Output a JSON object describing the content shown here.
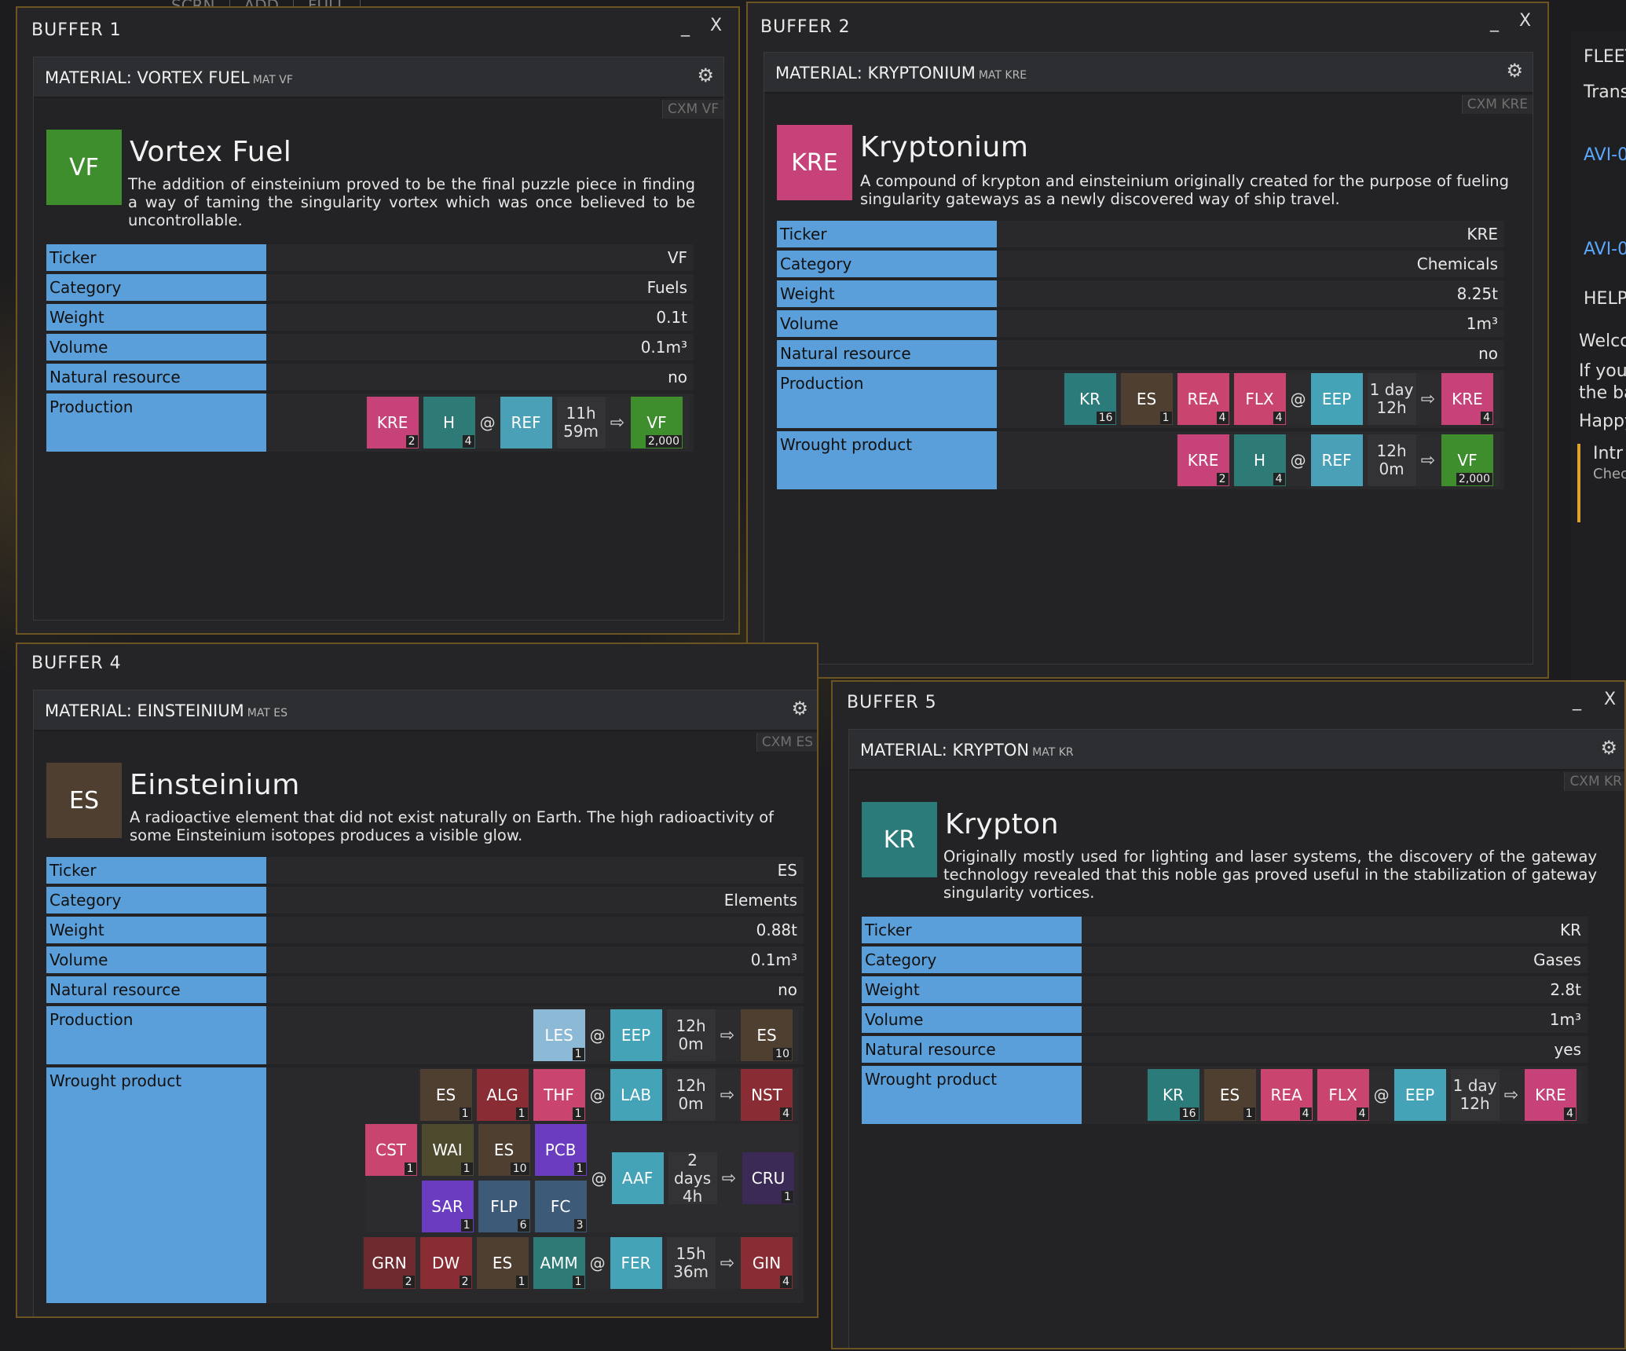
{
  "topbar": [
    "SCRN",
    "ADD",
    "FULL"
  ],
  "right_panel": {
    "fleet": "FLEET",
    "trans": "Trans",
    "avi1": "AVI-0",
    "avi2": "AVI-0",
    "help": "HELP",
    "welc": "Welco",
    "ifyou": "If you",
    "theba": "the ba",
    "happy": "Happy",
    "intr": "Intr",
    "chec": "Chec"
  },
  "buffer1": {
    "title": "BUFFER 1",
    "minimize": "_",
    "close": "X",
    "header": "MATERIAL: VORTEX FUEL",
    "header_small": "MAT VF",
    "cxm": "CXM VF",
    "icon": "VF",
    "name": "Vortex Fuel",
    "desc": "The addition of einsteinium proved to be the final puzzle piece in finding a way of taming the singularity vortex which was once believed to be uncontrollable.",
    "rows": [
      {
        "label": "Ticker",
        "value": "VF"
      },
      {
        "label": "Category",
        "value": "Fuels"
      },
      {
        "label": "Weight",
        "value": "0.1t"
      },
      {
        "label": "Volume",
        "value": "0.1m³"
      },
      {
        "label": "Natural resource",
        "value": "no"
      }
    ],
    "production_label": "Production",
    "production": {
      "inputs": [
        {
          "t": "KRE",
          "n": "2"
        },
        {
          "t": "H",
          "n": "4"
        }
      ],
      "at": "@",
      "building": "REF",
      "dur1": "11h",
      "dur2": "59m",
      "arrow": "⇨",
      "output": {
        "t": "VF",
        "n": "2,000"
      }
    }
  },
  "buffer2": {
    "title": "BUFFER 2",
    "minimize": "_",
    "close": "X",
    "header": "MATERIAL: KRYPTONIUM",
    "header_small": "MAT KRE",
    "cxm": "CXM KRE",
    "icon": "KRE",
    "name": "Kryptonium",
    "desc": "A compound of krypton and einsteinium originally created for the purpose of fueling singularity gateways as a newly discovered way of ship travel.",
    "rows": [
      {
        "label": "Ticker",
        "value": "KRE"
      },
      {
        "label": "Category",
        "value": "Chemicals"
      },
      {
        "label": "Weight",
        "value": "8.25t"
      },
      {
        "label": "Volume",
        "value": "1m³"
      },
      {
        "label": "Natural resource",
        "value": "no"
      }
    ],
    "production_label": "Production",
    "production": {
      "inputs": [
        {
          "t": "KR",
          "n": "16"
        },
        {
          "t": "ES",
          "n": "1"
        },
        {
          "t": "REA",
          "n": "4"
        },
        {
          "t": "FLX",
          "n": "4"
        }
      ],
      "at": "@",
      "building": "EEP",
      "dur1": "1 day",
      "dur2": "12h",
      "arrow": "⇨",
      "output": {
        "t": "KRE",
        "n": "4"
      }
    },
    "wrought_label": "Wrought product",
    "wrought": {
      "inputs": [
        {
          "t": "KRE",
          "n": "2"
        },
        {
          "t": "H",
          "n": "4"
        }
      ],
      "at": "@",
      "building": "REF",
      "dur1": "12h",
      "dur2": "0m",
      "arrow": "⇨",
      "output": {
        "t": "VF",
        "n": "2,000"
      }
    }
  },
  "buffer4": {
    "title": "BUFFER 4",
    "header": "MATERIAL: EINSTEINIUM",
    "header_small": "MAT ES",
    "cxm": "CXM ES",
    "icon": "ES",
    "name": "Einsteinium",
    "desc": "A radioactive element that did not exist naturally on Earth. The high radioactivity of some Einsteinium isotopes produces a visible glow.",
    "rows": [
      {
        "label": "Ticker",
        "value": "ES"
      },
      {
        "label": "Category",
        "value": "Elements"
      },
      {
        "label": "Weight",
        "value": "0.88t"
      },
      {
        "label": "Volume",
        "value": "0.1m³"
      },
      {
        "label": "Natural resource",
        "value": "no"
      }
    ],
    "production_label": "Production",
    "production": {
      "inputs": [
        {
          "t": "LES",
          "n": "1"
        }
      ],
      "at": "@",
      "building": "EEP",
      "dur1": "12h",
      "dur2": "0m",
      "arrow": "⇨",
      "output": {
        "t": "ES",
        "n": "10"
      }
    },
    "wrought_label": "Wrought product",
    "w1": {
      "inputs": [
        {
          "t": "ES",
          "n": "1"
        },
        {
          "t": "ALG",
          "n": "1"
        },
        {
          "t": "THF",
          "n": "1"
        }
      ],
      "building": "LAB",
      "dur1": "12h",
      "dur2": "0m",
      "output": {
        "t": "NST",
        "n": "4"
      }
    },
    "w2": {
      "inputs_a": [
        {
          "t": "CST",
          "n": "1"
        },
        {
          "t": "WAI",
          "n": "1"
        },
        {
          "t": "ES",
          "n": "10"
        },
        {
          "t": "PCB",
          "n": "1"
        }
      ],
      "inputs_b": [
        {
          "t": "SAR",
          "n": "1"
        },
        {
          "t": "FLP",
          "n": "6"
        },
        {
          "t": "FC",
          "n": "3"
        }
      ],
      "building": "AAF",
      "dur1": "2 days",
      "dur2": "4h",
      "output": {
        "t": "CRU",
        "n": "1"
      }
    },
    "w3": {
      "inputs": [
        {
          "t": "GRN",
          "n": "2"
        },
        {
          "t": "DW",
          "n": "2"
        },
        {
          "t": "ES",
          "n": "1"
        },
        {
          "t": "AMM",
          "n": "1"
        }
      ],
      "building": "FER",
      "dur1": "15h",
      "dur2": "36m",
      "output": {
        "t": "GIN",
        "n": "4"
      }
    },
    "at": "@",
    "arrow": "⇨"
  },
  "buffer5": {
    "title": "BUFFER 5",
    "minimize": "_",
    "close": "X",
    "header": "MATERIAL: KRYPTON",
    "header_small": "MAT KR",
    "cxm": "CXM KR",
    "icon": "KR",
    "name": "Krypton",
    "desc": "Originally mostly used for lighting and laser systems, the discovery of the gateway technology revealed that this noble gas proved useful in the stabilization of gateway singularity vortices.",
    "rows": [
      {
        "label": "Ticker",
        "value": "KR"
      },
      {
        "label": "Category",
        "value": "Gases"
      },
      {
        "label": "Weight",
        "value": "2.8t"
      },
      {
        "label": "Volume",
        "value": "1m³"
      },
      {
        "label": "Natural resource",
        "value": "yes"
      }
    ],
    "wrought_label": "Wrought product",
    "wrought": {
      "inputs": [
        {
          "t": "KR",
          "n": "16"
        },
        {
          "t": "ES",
          "n": "1"
        },
        {
          "t": "REA",
          "n": "4"
        },
        {
          "t": "FLX",
          "n": "4"
        }
      ],
      "at": "@",
      "building": "EEP",
      "dur1": "1 day",
      "dur2": "12h",
      "arrow": "⇨",
      "output": {
        "t": "KRE",
        "n": "4"
      }
    }
  },
  "colors": {
    "label_blue": "#5a9fd9",
    "border_gold": "#6d5523"
  }
}
